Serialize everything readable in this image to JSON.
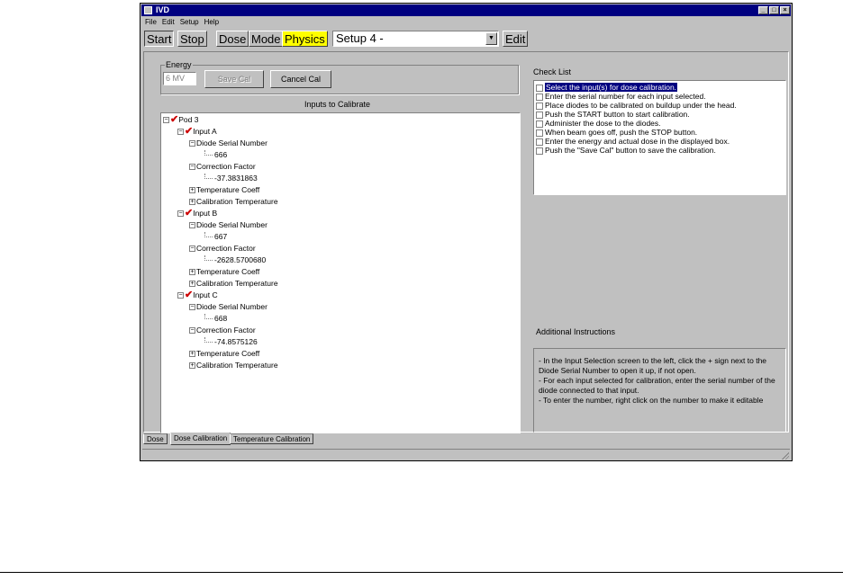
{
  "window": {
    "title": "IVD"
  },
  "menu": [
    "File",
    "Edit",
    "Setup",
    "Help"
  ],
  "toolbar": {
    "start": "Start",
    "stop": "Stop",
    "dose": "Dose",
    "mode": "Mode",
    "physics": "Physics",
    "setup_value": "Setup 4 -",
    "edit": "Edit"
  },
  "energy": {
    "legend": "Energy",
    "value": "6 MV",
    "save_cal": "Save Cal",
    "cancel_cal": "Cancel Cal"
  },
  "inputs_title": "Inputs to Calibrate",
  "tree": {
    "pod": "Pod 3",
    "inputs": [
      {
        "name": "Input A",
        "serial_label": "Diode Serial Number",
        "serial": "666",
        "cf_label": "Correction Factor",
        "cf": "-37.3831863",
        "temp_label": "Temperature Coeff",
        "caltemp_label": "Calibration Temperature"
      },
      {
        "name": "Input B",
        "serial_label": "Diode Serial Number",
        "serial": "667",
        "cf_label": "Correction Factor",
        "cf": "-2628.5700680",
        "temp_label": "Temperature Coeff",
        "caltemp_label": "Calibration Temperature"
      },
      {
        "name": "Input C",
        "serial_label": "Diode Serial Number",
        "serial": "668",
        "cf_label": "Correction Factor",
        "cf": "-74.8575126",
        "temp_label": "Temperature Coeff",
        "caltemp_label": "Calibration Temperature"
      }
    ]
  },
  "checklist": {
    "title": "Check List",
    "items": [
      "Select the input(s) for dose calibration.",
      "Enter the serial number for each input selected.",
      "Place diodes to be calibrated on buildup under the head.",
      "Push the START button to start calibration.",
      "Administer the dose to the diodes.",
      "When beam goes off, push the STOP button.",
      "Enter the energy and actual dose in the displayed box.",
      "Push the \"Save Cal\" button to save the calibration."
    ]
  },
  "instructions": {
    "title": "Additional Instructions",
    "lines": [
      "- In the Input Selection screen to the left, click the + sign next to the Diode Serial Number to open it up, if not open.",
      "- For each input selected for calibration, enter the serial number of the diode connected to that input.",
      "- To enter the number, right click on the number to make it editable"
    ]
  },
  "tabs": [
    "Dose",
    "Dose Calibration",
    "Temperature Calibration"
  ],
  "colors": {
    "titlebar": "#000080",
    "physics": "#ffff00",
    "check": "#cc0000"
  }
}
